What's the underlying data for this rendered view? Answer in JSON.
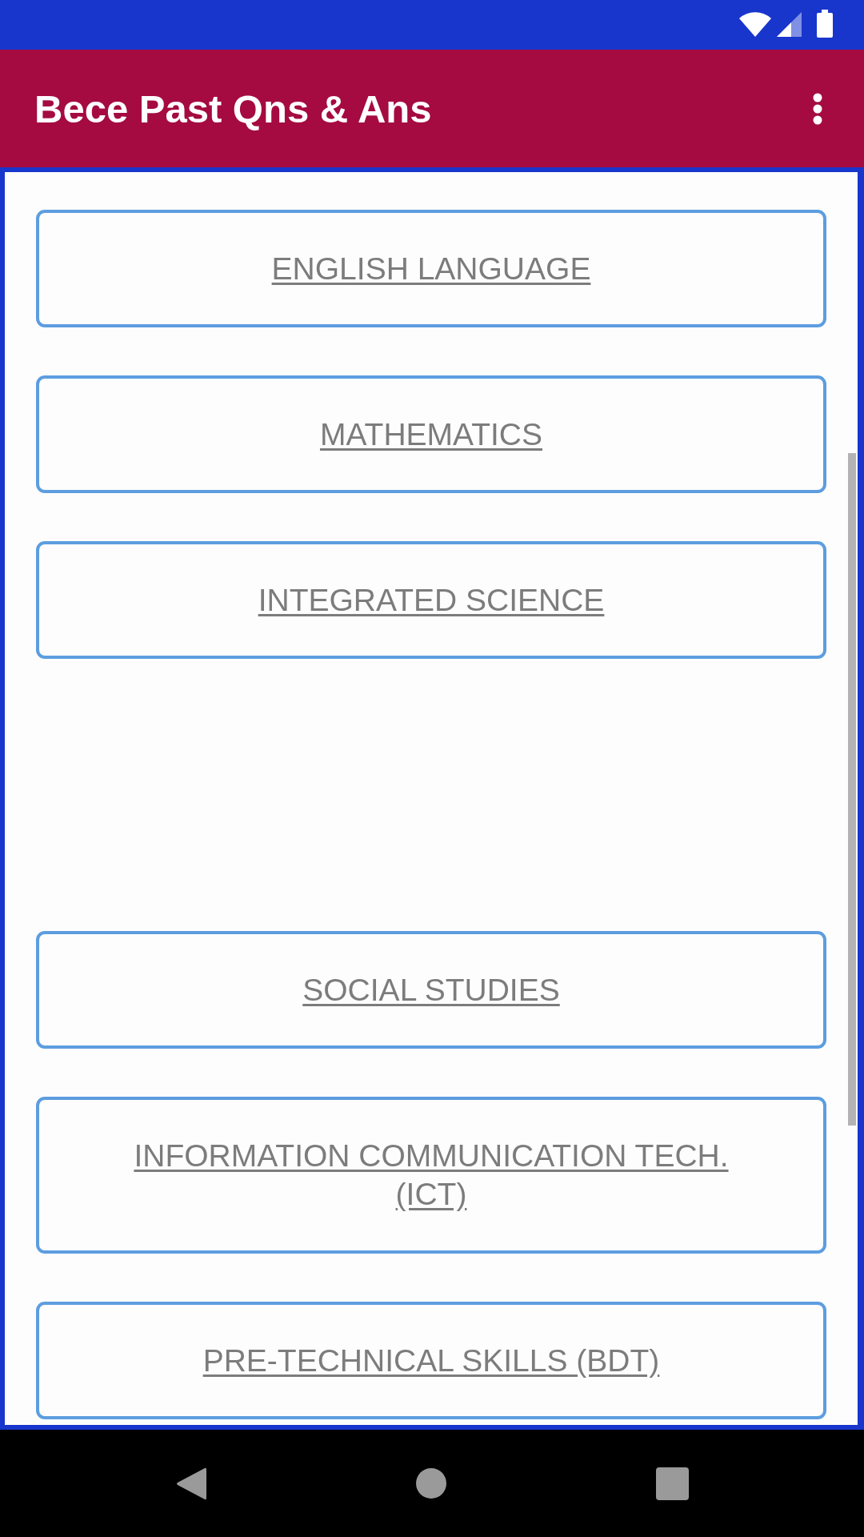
{
  "app_bar": {
    "title": "Bece Past Qns & Ans"
  },
  "subjects": [
    {
      "label": "ENGLISH LANGUAGE"
    },
    {
      "label": "MATHEMATICS"
    },
    {
      "label": "INTEGRATED SCIENCE"
    },
    {
      "label": "SOCIAL STUDIES"
    },
    {
      "label": "INFORMATION COMMUNICATION TECH. (ICT)"
    },
    {
      "label": "PRE-TECHNICAL SKILLS (BDT)"
    }
  ]
}
